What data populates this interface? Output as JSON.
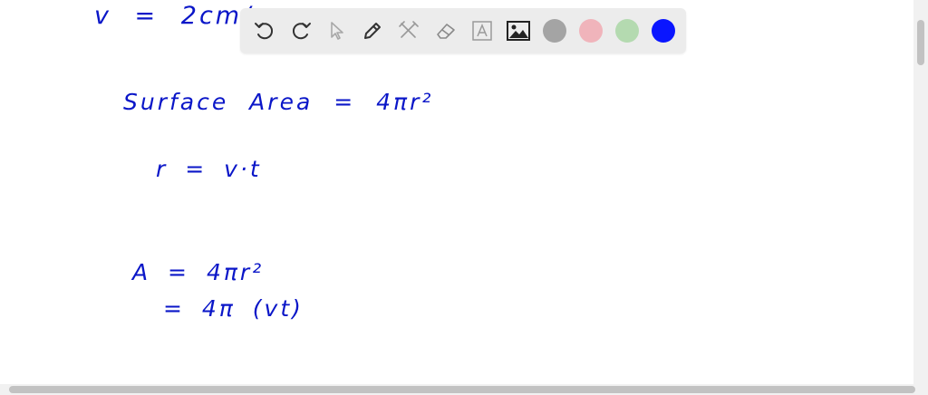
{
  "notes": {
    "line1": "v = 2cm/s",
    "line2": "Surface Area = 4πr²",
    "line3": "r = v·t",
    "line4": "A = 4πr²",
    "line5": "= 4π (vt)"
  },
  "toolbar": {
    "tools": [
      "undo-icon",
      "redo-icon",
      "pointer-icon",
      "pen-icon",
      "tools-icon",
      "eraser-icon",
      "text-icon",
      "image-icon"
    ],
    "colors": [
      "#a4a4a4",
      "#f0b4bb",
      "#b4dab0",
      "#0a16ff"
    ],
    "selected_color": "#0a16ff"
  }
}
